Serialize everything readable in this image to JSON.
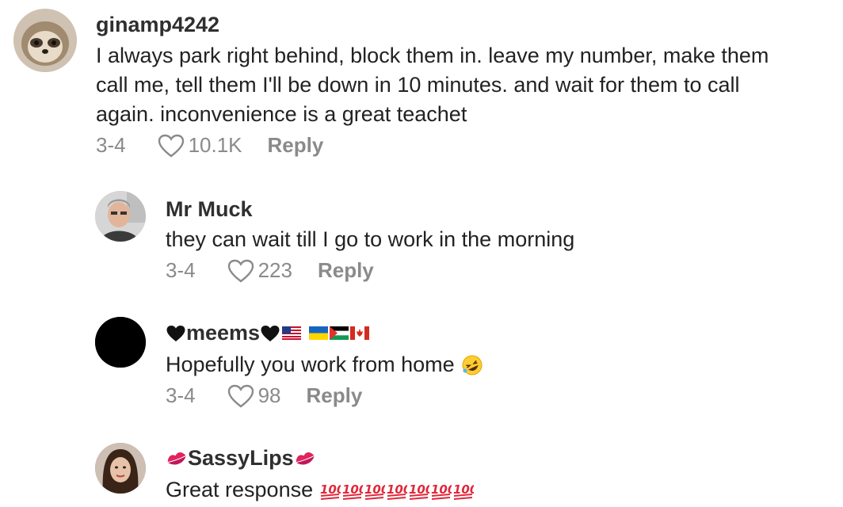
{
  "comments": [
    {
      "username": "ginamp4242",
      "lines": [
        "I always park right behind, block them in. leave my number, make them",
        "call me, tell them I'll be down in 10 minutes. and wait for them to call",
        "again. inconvenience is a great teachet"
      ],
      "date": "3-4",
      "likes": "10.1K",
      "reply_label": "Reply",
      "avatar": "sloth-avatar"
    },
    {
      "username": "Mr Muck",
      "lines": [
        "they can wait till I go to work in the morning"
      ],
      "date": "3-4",
      "likes": "223",
      "reply_label": "Reply",
      "avatar": "man-avatar"
    },
    {
      "username": "meems",
      "username_prefix_icon": "black-heart",
      "username_suffix_icons": [
        "black-heart",
        "us-flag",
        "ukraine-flag",
        "palestine-flag",
        "canada-flag"
      ],
      "lines": [
        "Hopefully you work from home"
      ],
      "line_suffix_icon": "rolling-laughing-emoji",
      "date": "3-4",
      "likes": "98",
      "reply_label": "Reply",
      "avatar": "black-circle-avatar"
    },
    {
      "username": "SassyLips",
      "username_prefix_icon": "kiss-mark",
      "username_suffix_icons": [
        "kiss-mark"
      ],
      "lines": [
        "Great response"
      ],
      "line_suffix_icons": [
        "100-emoji",
        "100-emoji",
        "100-emoji",
        "100-emoji",
        "100-emoji",
        "100-emoji",
        "100-emoji"
      ],
      "avatar": "woman-avatar"
    }
  ],
  "colors": {
    "meta": "#8a8a8a",
    "text": "#222222",
    "username": "#2f2f2f"
  }
}
